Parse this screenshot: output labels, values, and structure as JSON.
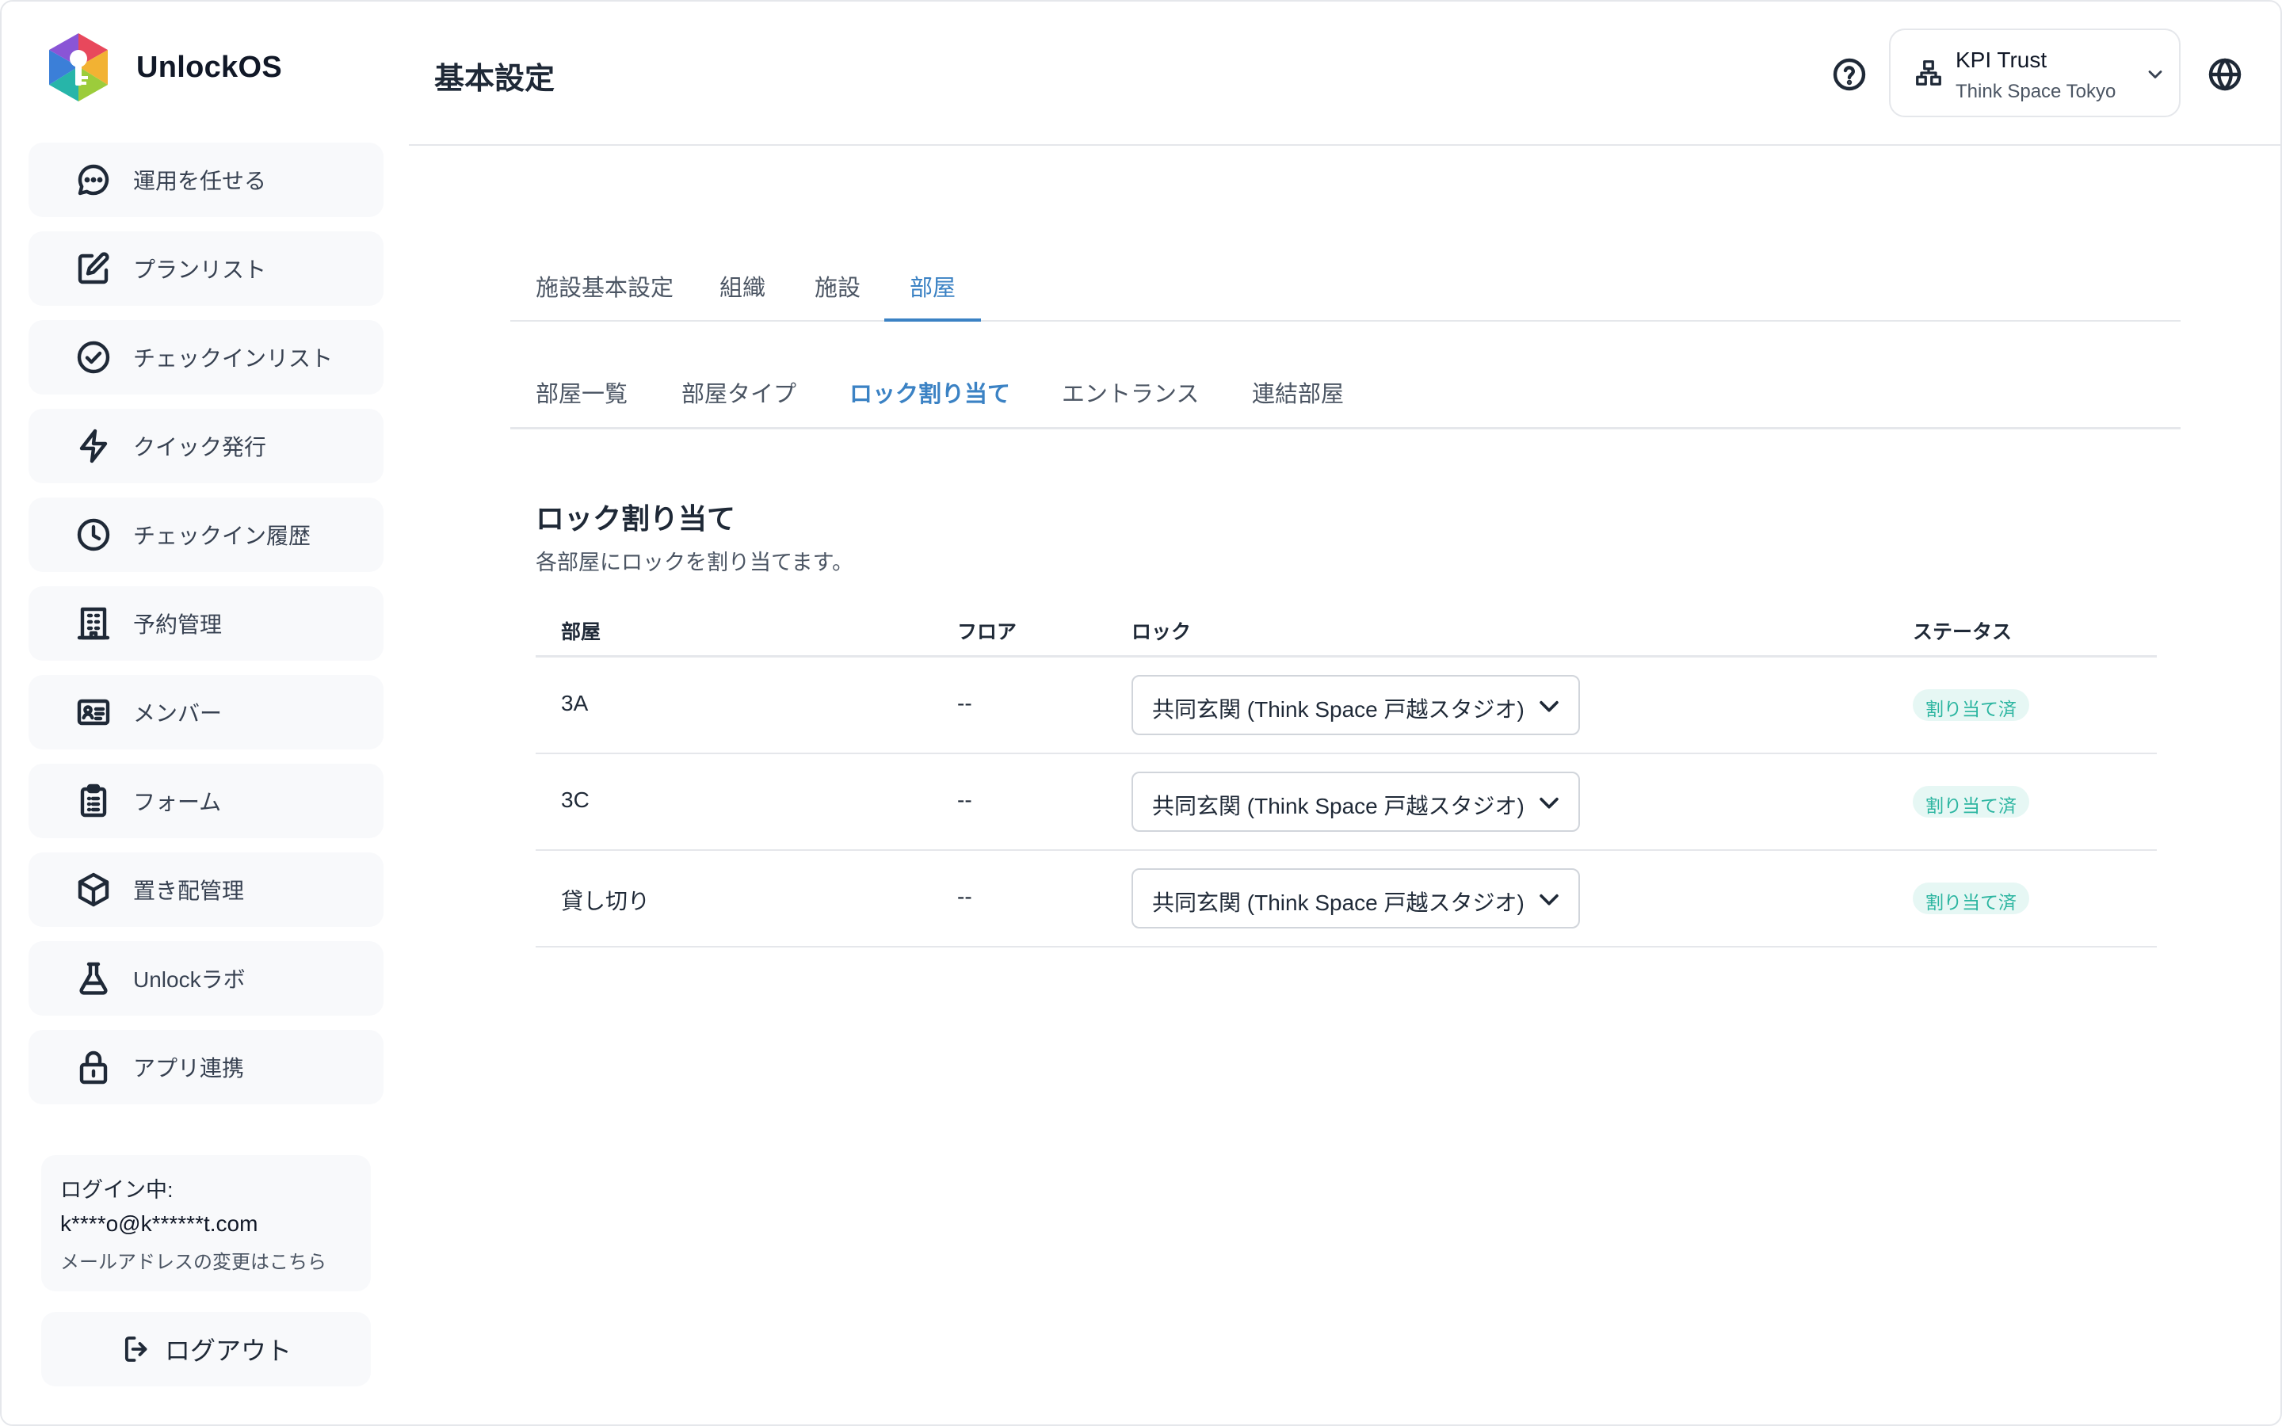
{
  "app": {
    "name": "UnlockOS"
  },
  "sidebar": {
    "items": [
      {
        "label": "運用を任せる",
        "icon": "chat-bubble-icon"
      },
      {
        "label": "プランリスト",
        "icon": "edit-square-icon"
      },
      {
        "label": "チェックインリスト",
        "icon": "check-circle-icon"
      },
      {
        "label": "クイック発行",
        "icon": "lightning-icon"
      },
      {
        "label": "チェックイン履歴",
        "icon": "clock-icon"
      },
      {
        "label": "予約管理",
        "icon": "building-icon"
      },
      {
        "label": "メンバー",
        "icon": "id-card-icon"
      },
      {
        "label": "フォーム",
        "icon": "clipboard-icon"
      },
      {
        "label": "置き配管理",
        "icon": "package-icon"
      },
      {
        "label": "Unlockラボ",
        "icon": "flask-icon"
      },
      {
        "label": "アプリ連携",
        "icon": "lock-icon"
      }
    ],
    "login": {
      "label": "ログイン中:",
      "email": "k****o@k******t.com",
      "change_link": "メールアドレスの変更はこちら"
    },
    "logout_label": "ログアウト"
  },
  "header": {
    "title": "基本設定",
    "org_name": "KPI Trust",
    "org_sub": "Think Space Tokyo"
  },
  "tabs_primary": [
    {
      "label": "施設基本設定",
      "active": false
    },
    {
      "label": "組織",
      "active": false
    },
    {
      "label": "施設",
      "active": false
    },
    {
      "label": "部屋",
      "active": true
    }
  ],
  "tabs_secondary": [
    {
      "label": "部屋一覧",
      "active": false
    },
    {
      "label": "部屋タイプ",
      "active": false
    },
    {
      "label": "ロック割り当て",
      "active": true
    },
    {
      "label": "エントランス",
      "active": false
    },
    {
      "label": "連結部屋",
      "active": false
    }
  ],
  "section": {
    "title": "ロック割り当て",
    "description": "各部屋にロックを割り当てます。"
  },
  "table": {
    "headers": {
      "room": "部屋",
      "floor": "フロア",
      "lock": "ロック",
      "status": "ステータス"
    },
    "rows": [
      {
        "room": "3A",
        "floor": "--",
        "lock": "共同玄関 (Think Space 戸越スタジオ)",
        "status": "割り当て済"
      },
      {
        "room": "3C",
        "floor": "--",
        "lock": "共同玄関 (Think Space 戸越スタジオ)",
        "status": "割り当て済"
      },
      {
        "room": "貸し切り",
        "floor": "--",
        "lock": "共同玄関 (Think Space 戸越スタジオ)",
        "status": "割り当て済"
      }
    ]
  },
  "colors": {
    "accent": "#3b82c4",
    "status_text": "#2bb5a0",
    "status_bg": "#e6f7f4",
    "nav_bg": "#f8f9fb",
    "border": "#e5e7eb"
  }
}
